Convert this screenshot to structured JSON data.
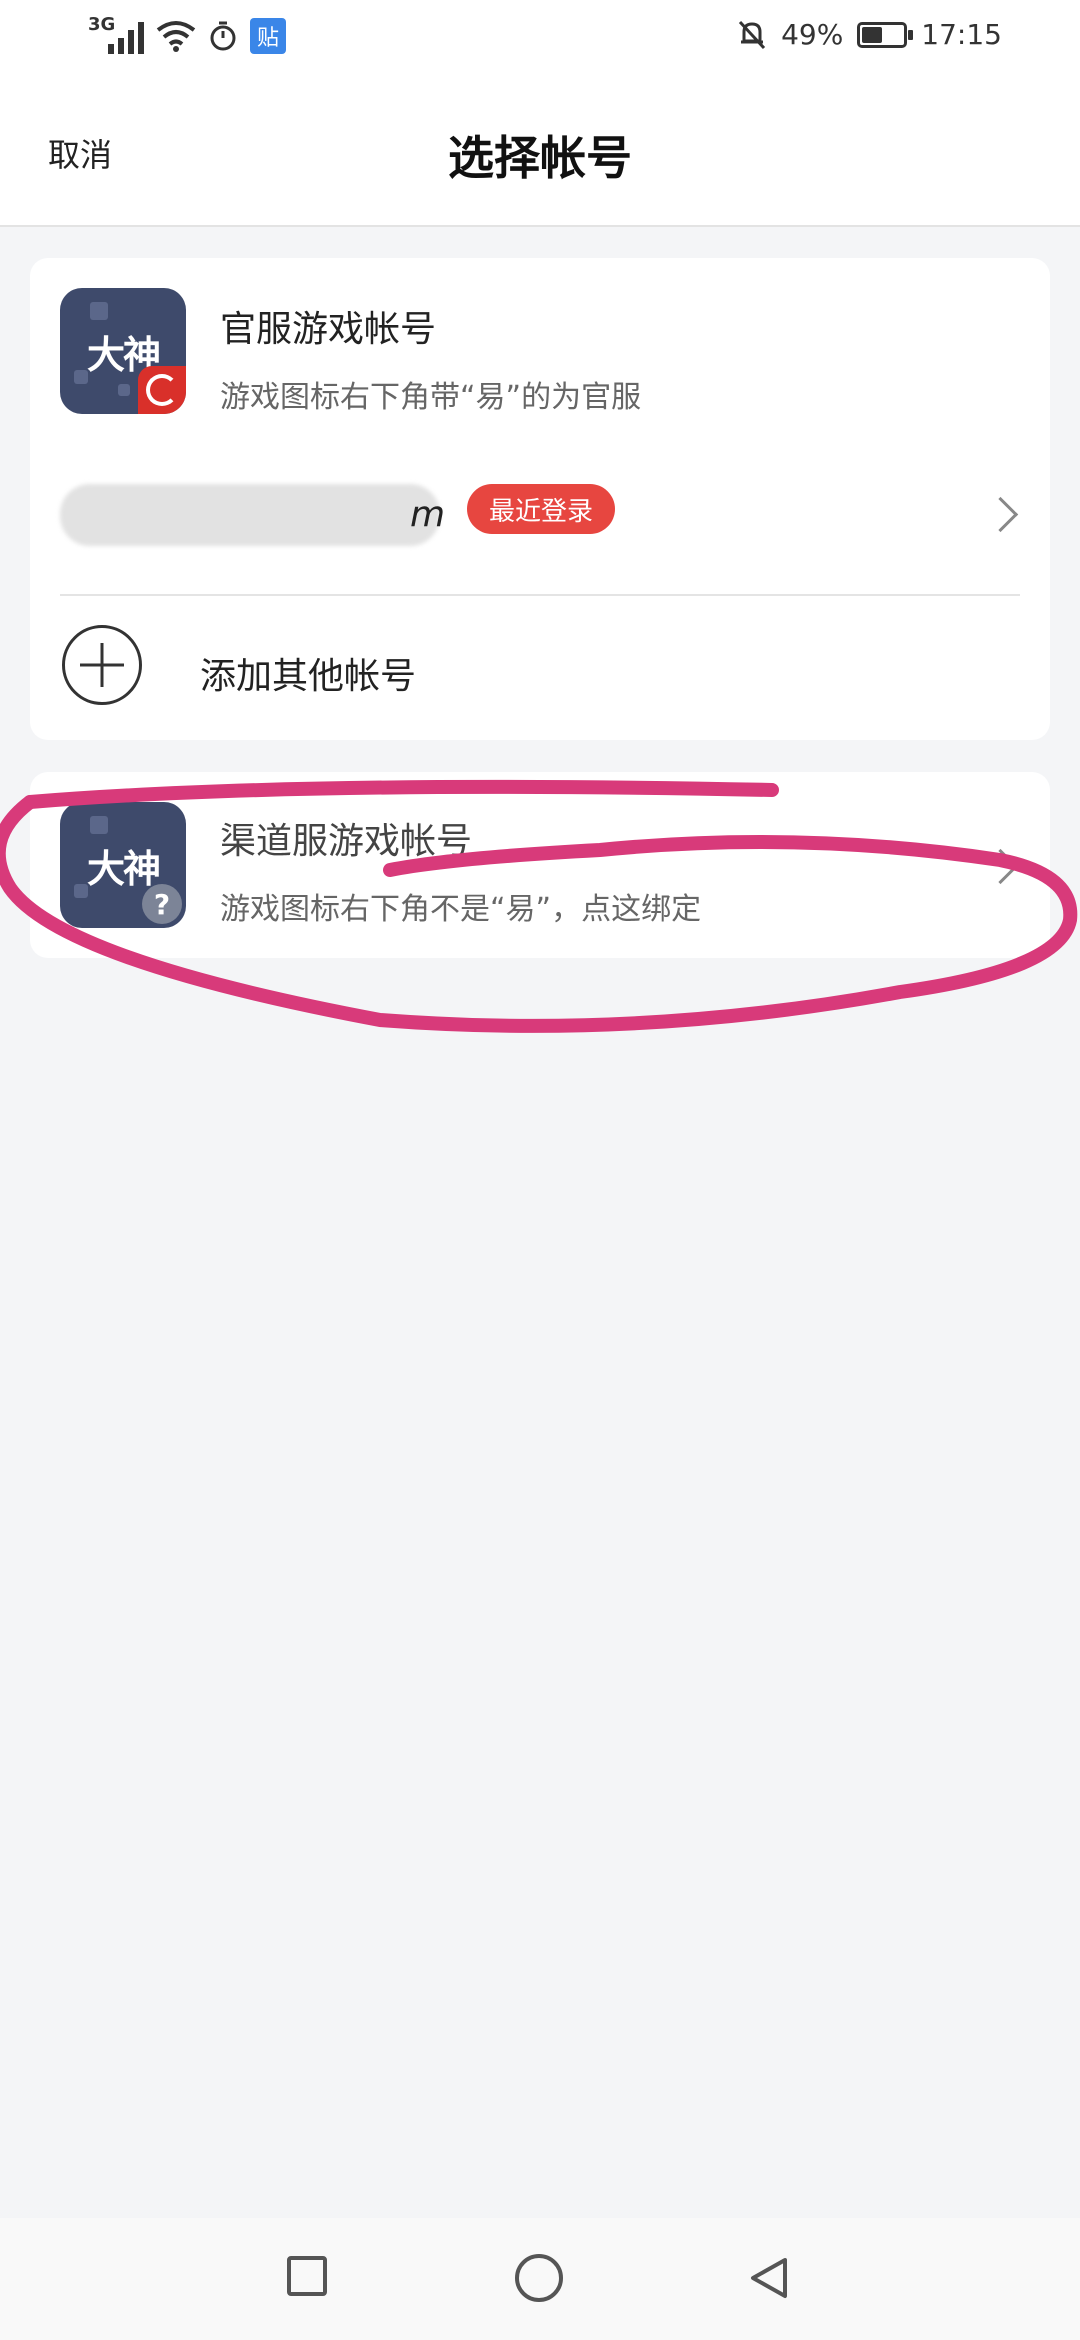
{
  "status_bar": {
    "network": "3G",
    "tieba_label": "贴",
    "battery_percent": "49%",
    "battery_level": 0.49,
    "time": "17:15"
  },
  "header": {
    "cancel_label": "取消",
    "title": "选择帐号"
  },
  "official_section": {
    "icon_text": "大神",
    "title": "官服游戏帐号",
    "subtitle": "游戏图标右下角带“易”的为官服",
    "account_suffix": "m",
    "recent_badge": "最近登录",
    "add_label": "添加其他帐号"
  },
  "channel_section": {
    "icon_text": "大神",
    "badge": "?",
    "title": "渠道服游戏帐号",
    "subtitle": "游戏图标右下角不是“易”，点这绑定"
  },
  "colors": {
    "annotation": "#d83a7a",
    "recent_badge": "#e74640",
    "icon_bg": "#3e4a6b"
  }
}
